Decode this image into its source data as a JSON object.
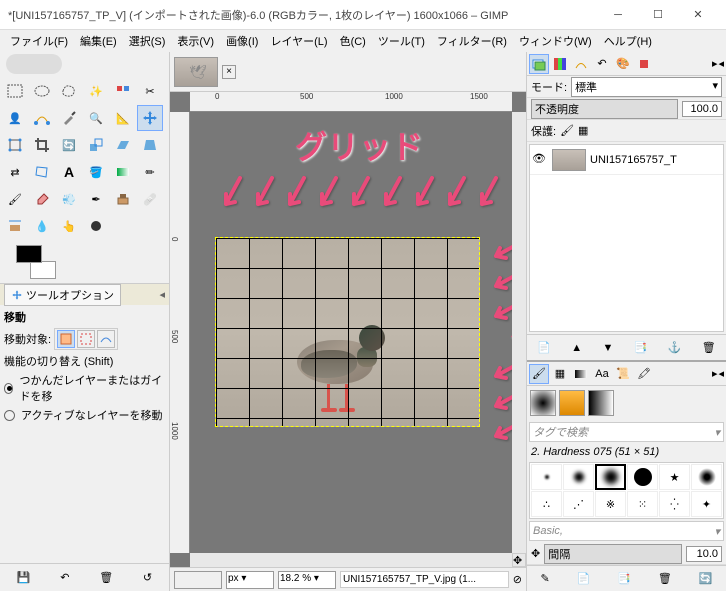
{
  "title": "*[UNI157165757_TP_V] (インポートされた画像)-6.0 (RGBカラー, 1枚のレイヤー) 1600x1066 – GIMP",
  "menu": [
    "ファイル(F)",
    "編集(E)",
    "選択(S)",
    "表示(V)",
    "画像(I)",
    "レイヤー(L)",
    "色(C)",
    "ツール(T)",
    "フィルター(R)",
    "ウィンドウ(W)",
    "ヘルプ(H)"
  ],
  "tool_options": {
    "title": "ツールオプション",
    "target_label": "移動対象:",
    "toggle_label": "機能の切り替え (Shift)",
    "radio1": "つかんだレイヤーまたはガイドを移",
    "radio2": "アクティブなレイヤーを移動"
  },
  "status": {
    "unit": "px ▾",
    "zoom": "18.2 % ▾",
    "file": "UNI157165757_TP_V.jpg (1..."
  },
  "right": {
    "mode_label": "モード:",
    "mode_value": "標準",
    "opacity_label": "不透明度",
    "opacity_value": "100.0",
    "lock_label": "保護:",
    "layer_name": "UNI157165757_T",
    "search": "タグで検索",
    "brush_name": "2. Hardness 075 (51 × 51)",
    "preset": "Basic,",
    "spacing_label": "間隔",
    "spacing_value": "10.0"
  },
  "annotation": "グリッド",
  "ruler_h": [
    "0",
    "500",
    "1000",
    "1500"
  ],
  "ruler_v": [
    "0",
    "500",
    "1000"
  ]
}
